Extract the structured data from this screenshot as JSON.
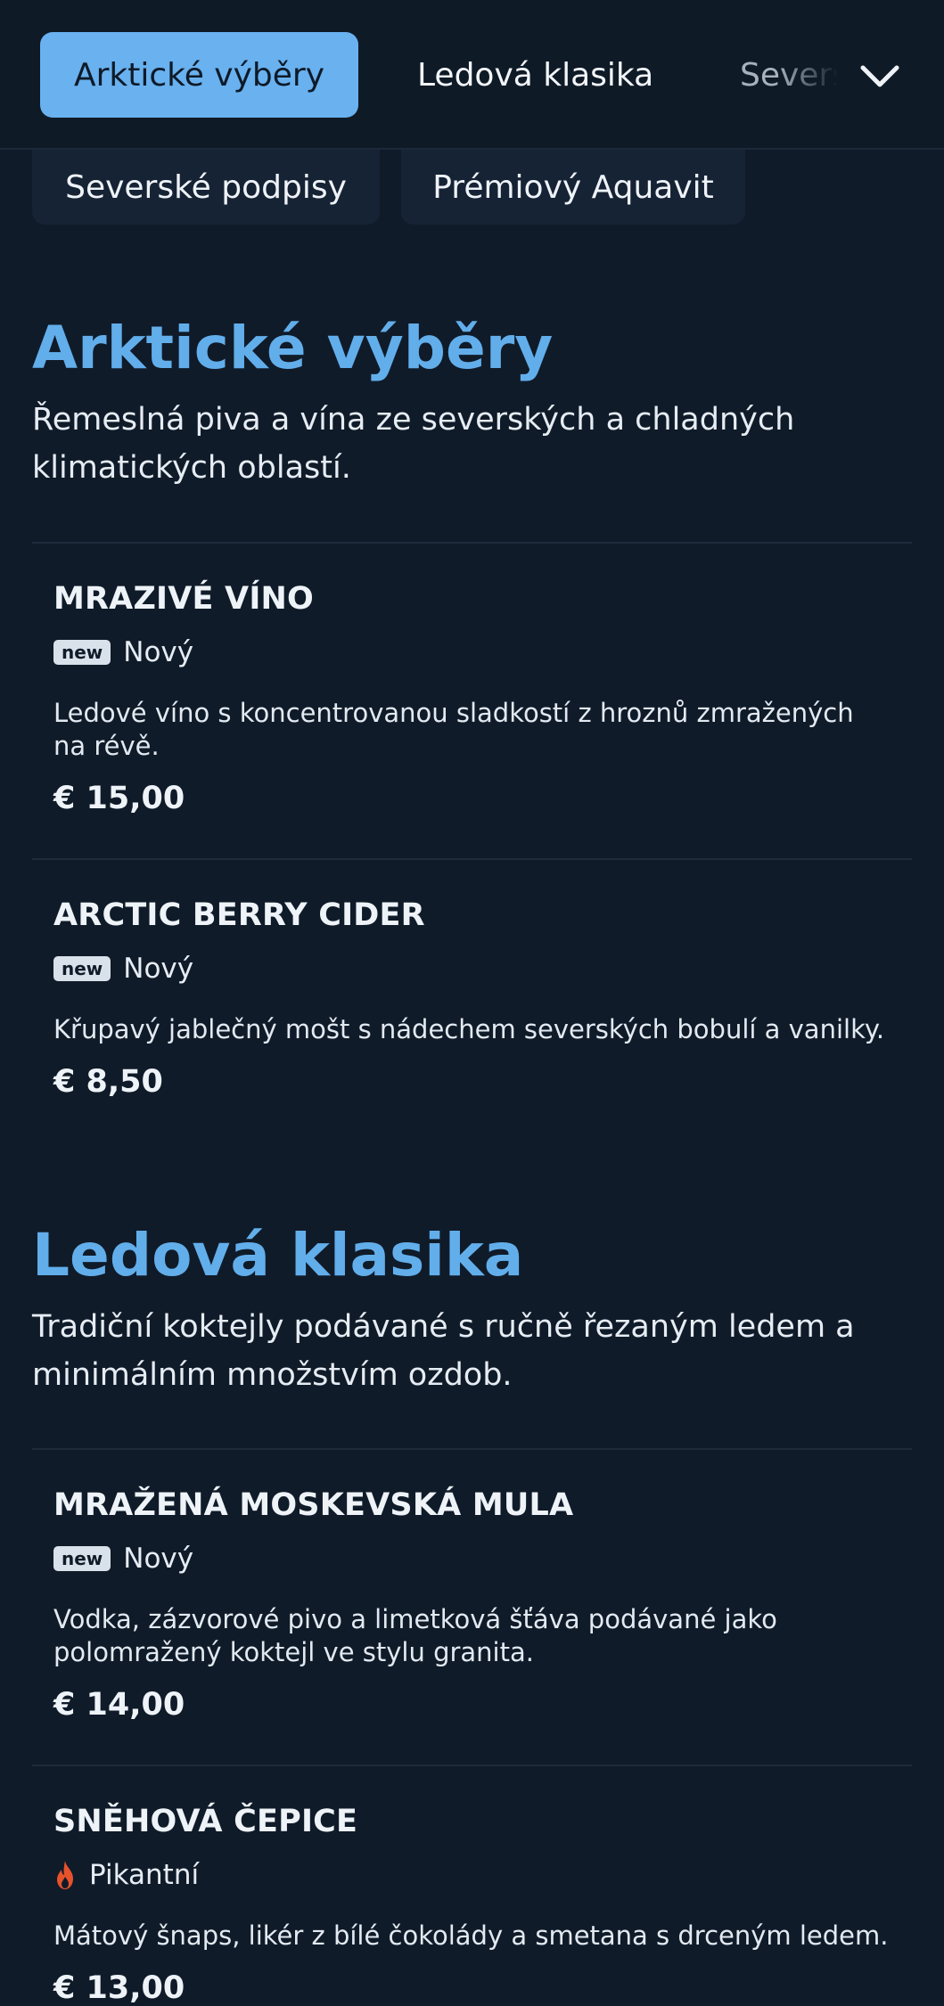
{
  "nav": {
    "tabs": [
      {
        "label": "Arktické výběry"
      },
      {
        "label": "Ledová klasika"
      },
      {
        "label": "Severské podpisy"
      }
    ],
    "more_icon": "chevron-down-icon",
    "chips": [
      {
        "label": "Severské podpisy"
      },
      {
        "label": "Prémiový Aquavit"
      }
    ]
  },
  "sections": [
    {
      "title": "Arktické výběry",
      "description": "Řemeslná piva a vína ze severských a chladných klimatických oblastí.",
      "items": [
        {
          "name": "MRAZIVÉ VÍNO",
          "badge": "new",
          "tag": "Nový",
          "description": "Ledové víno s koncentrovanou sladkostí z hroznů zmražených na révě.",
          "price": "€ 15,00"
        },
        {
          "name": "ARCTIC BERRY CIDER",
          "badge": "new",
          "tag": "Nový",
          "description": "Křupavý jablečný mošt s nádechem severských bobulí a vanilky.",
          "price": "€ 8,50"
        }
      ]
    },
    {
      "title": "Ledová klasika",
      "description": "Tradiční koktejly podávané s ručně řezaným ledem a minimálním množstvím ozdob.",
      "items": [
        {
          "name": "MRAŽENÁ MOSKEVSKÁ MULA",
          "badge": "new",
          "tag": "Nový",
          "description": "Vodka, zázvorové pivo a limetková šťáva podávané jako polomražený koktejl ve stylu granita.",
          "price": "€ 14,00"
        },
        {
          "name": "SNĚHOVÁ ČEPICE",
          "icon": "flame-icon",
          "tag": "Pikantní",
          "description": "Mátový šnaps, likér z bílé čokolády a smetana s drceným ledem.",
          "price": "€ 13,00"
        }
      ]
    }
  ],
  "colors": {
    "background": "#101b29",
    "accent": "#62aeeb",
    "active_tab": "#69b1ef",
    "spicy": "#e5522b"
  }
}
